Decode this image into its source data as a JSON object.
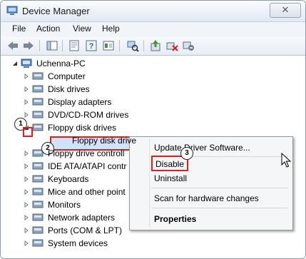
{
  "window": {
    "title": "Device Manager",
    "close_glyph": "✕"
  },
  "menu": [
    "File",
    "Action",
    "View",
    "Help"
  ],
  "toolbar": {
    "buttons": [
      "back-icon",
      "forward-icon",
      "show-hide-tree-icon",
      "properties-icon",
      "help-icon",
      "console-icon",
      "scan-hardware-icon",
      "update-driver-icon",
      "uninstall-icon",
      "disable-icon"
    ]
  },
  "tree": {
    "root": "Uchenna-PC",
    "items": [
      {
        "label": "Computer",
        "icon": "computer-icon"
      },
      {
        "label": "Disk drives",
        "icon": "disk-drive-icon"
      },
      {
        "label": "Display adapters",
        "icon": "display-adapter-icon"
      },
      {
        "label": "DVD/CD-ROM drives",
        "icon": "dvd-drive-icon"
      },
      {
        "label": "Floppy disk drives",
        "icon": "floppy-icon",
        "expanded": true
      },
      {
        "label": "Floppy disk drive",
        "icon": "floppy-device-icon",
        "child": true,
        "selected": true
      },
      {
        "label": "Floppy drive controll",
        "icon": "controller-icon"
      },
      {
        "label": "IDE ATA/ATAPI contr",
        "icon": "ide-icon"
      },
      {
        "label": "Keyboards",
        "icon": "keyboard-icon"
      },
      {
        "label": "Mice and other point",
        "icon": "mouse-icon"
      },
      {
        "label": "Monitors",
        "icon": "monitor-icon"
      },
      {
        "label": "Network adapters",
        "icon": "network-icon"
      },
      {
        "label": "Ports (COM & LPT)",
        "icon": "port-icon"
      },
      {
        "label": "System devices",
        "icon": "system-icon"
      }
    ]
  },
  "context_menu": {
    "items": [
      "Update Driver Software...",
      "Disable",
      "Uninstall",
      "Scan for hardware changes",
      "Properties"
    ]
  },
  "steps": [
    "1",
    "2",
    "3"
  ],
  "colors": {
    "highlight_red": "#e21b1b",
    "selection_blue": "#cfe3fa"
  }
}
